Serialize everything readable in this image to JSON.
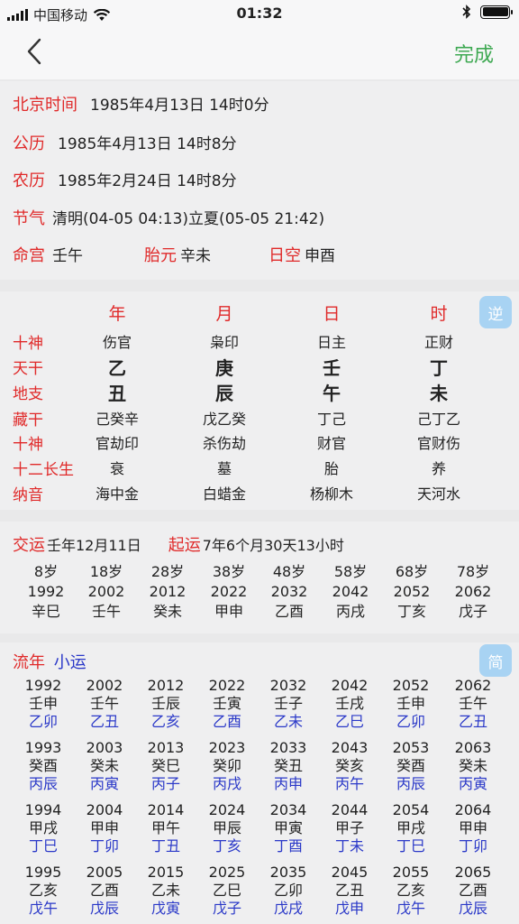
{
  "status": {
    "carrier": "中国移动",
    "time": "01:32"
  },
  "nav": {
    "done_label": "完成"
  },
  "info": {
    "beijing_label": "北京时间",
    "beijing_value": "1985年4月13日 14时0分",
    "gongli_label": "公历",
    "gongli_value": "1985年4月13日 14时8分",
    "nongli_label": "农历",
    "nongli_value": "1985年2月24日 14时8分",
    "jieqi_label": "节气",
    "jieqi_value": "清明(04-05 04:13)立夏(05-05 21:42)",
    "minggong_label": "命宫",
    "minggong_value": "壬午",
    "taiyuan_label": "胎元",
    "taiyuan_value": "辛未",
    "rikong_label": "日空",
    "rikong_value": "申酉"
  },
  "pillars": {
    "headers": [
      "年",
      "月",
      "日",
      "时"
    ],
    "badge": "逆",
    "row_labels": [
      "十神",
      "天干",
      "地支",
      "藏干",
      "十神",
      "十二长生",
      "纳音"
    ],
    "rows": [
      [
        "伤官",
        "枭印",
        "日主",
        "正财"
      ],
      [
        "乙",
        "庚",
        "壬",
        "丁"
      ],
      [
        "丑",
        "辰",
        "午",
        "未"
      ],
      [
        "己癸辛",
        "戊乙癸",
        "丁己",
        "己丁乙"
      ],
      [
        "官劫印",
        "杀伤劫",
        "财官",
        "官财伤"
      ],
      [
        "衰",
        "墓",
        "胎",
        "养"
      ],
      [
        "海中金",
        "白蜡金",
        "杨柳木",
        "天河水"
      ]
    ]
  },
  "dayun": {
    "jiaoyun_label": "交运",
    "jiaoyun_value": "壬年12月11日",
    "qiyun_label": "起运",
    "qiyun_value": "7年6个月30天13小时",
    "cols": [
      [
        "8岁",
        "1992",
        "辛巳"
      ],
      [
        "18岁",
        "2002",
        "壬午"
      ],
      [
        "28岁",
        "2012",
        "癸未"
      ],
      [
        "38岁",
        "2022",
        "甲申"
      ],
      [
        "48岁",
        "2032",
        "乙酉"
      ],
      [
        "58岁",
        "2042",
        "丙戌"
      ],
      [
        "68岁",
        "2052",
        "丁亥"
      ],
      [
        "78岁",
        "2062",
        "戊子"
      ]
    ]
  },
  "liunian": {
    "title_red": "流年",
    "title_blue": "小运",
    "badge": "简",
    "blocks": [
      [
        [
          "1992",
          "壬申",
          "乙卯"
        ],
        [
          "2002",
          "壬午",
          "乙丑"
        ],
        [
          "2012",
          "壬辰",
          "乙亥"
        ],
        [
          "2022",
          "壬寅",
          "乙酉"
        ],
        [
          "2032",
          "壬子",
          "乙未"
        ],
        [
          "2042",
          "壬戌",
          "乙巳"
        ],
        [
          "2052",
          "壬申",
          "乙卯"
        ],
        [
          "2062",
          "壬午",
          "乙丑"
        ]
      ],
      [
        [
          "1993",
          "癸酉",
          "丙辰"
        ],
        [
          "2003",
          "癸未",
          "丙寅"
        ],
        [
          "2013",
          "癸巳",
          "丙子"
        ],
        [
          "2023",
          "癸卯",
          "丙戌"
        ],
        [
          "2033",
          "癸丑",
          "丙申"
        ],
        [
          "2043",
          "癸亥",
          "丙午"
        ],
        [
          "2053",
          "癸酉",
          "丙辰"
        ],
        [
          "2063",
          "癸未",
          "丙寅"
        ]
      ],
      [
        [
          "1994",
          "甲戌",
          "丁巳"
        ],
        [
          "2004",
          "甲申",
          "丁卯"
        ],
        [
          "2014",
          "甲午",
          "丁丑"
        ],
        [
          "2024",
          "甲辰",
          "丁亥"
        ],
        [
          "2034",
          "甲寅",
          "丁酉"
        ],
        [
          "2044",
          "甲子",
          "丁未"
        ],
        [
          "2054",
          "甲戌",
          "丁巳"
        ],
        [
          "2064",
          "甲申",
          "丁卯"
        ]
      ],
      [
        [
          "1995",
          "乙亥",
          "戊午"
        ],
        [
          "2005",
          "乙酉",
          "戊辰"
        ],
        [
          "2015",
          "乙未",
          "戊寅"
        ],
        [
          "2025",
          "乙巳",
          "戊子"
        ],
        [
          "2035",
          "乙卯",
          "戊戌"
        ],
        [
          "2045",
          "乙丑",
          "戊申"
        ],
        [
          "2055",
          "乙亥",
          "戊午"
        ],
        [
          "2065",
          "乙酉",
          "戊辰"
        ]
      ]
    ]
  }
}
